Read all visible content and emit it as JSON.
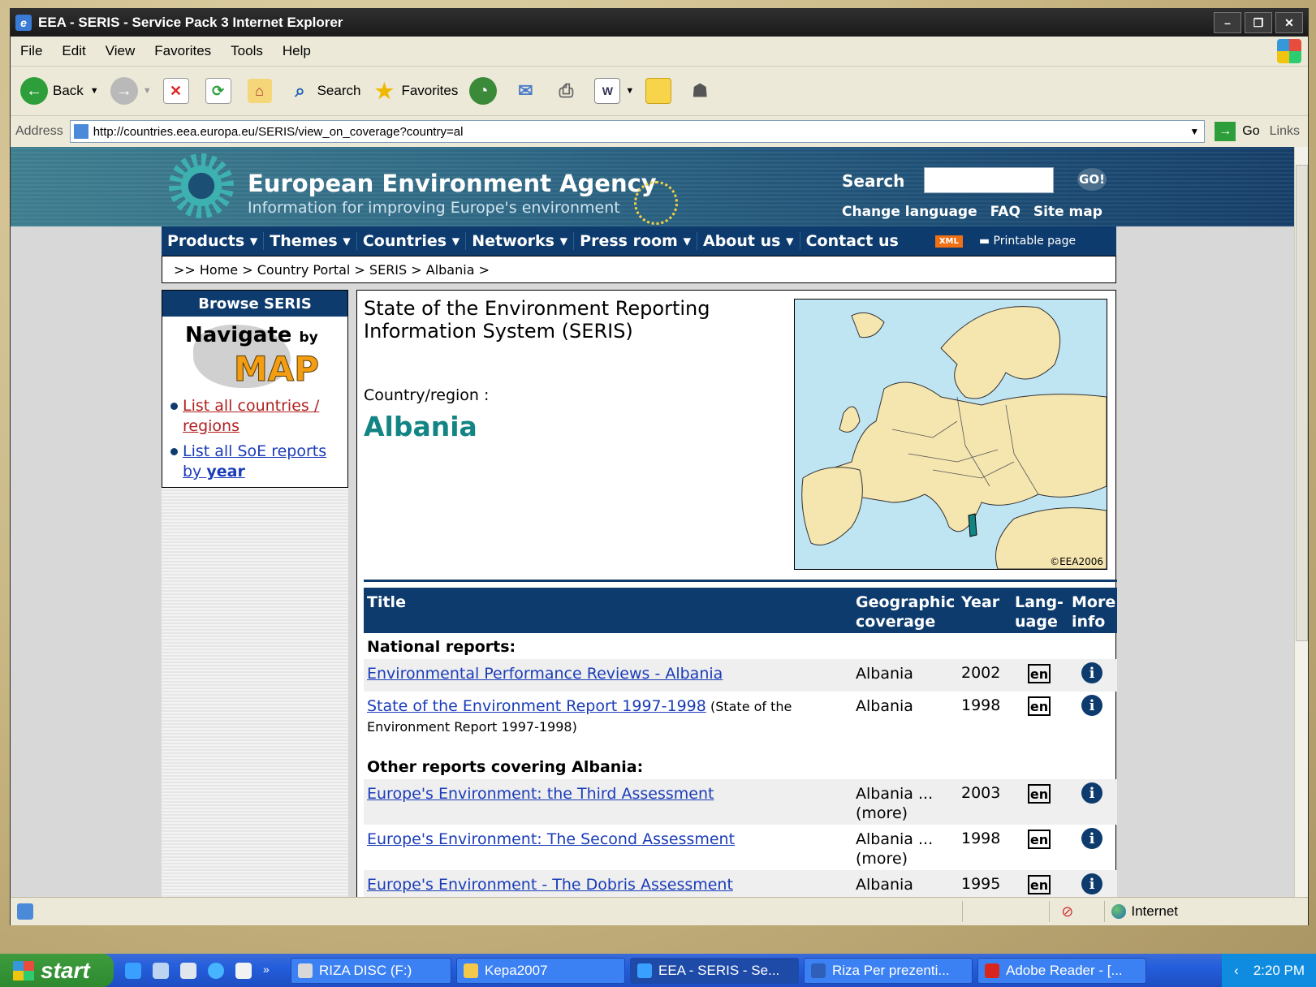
{
  "window": {
    "title": "EEA - SERIS - Service Pack 3 Internet Explorer"
  },
  "menu": [
    "File",
    "Edit",
    "View",
    "Favorites",
    "Tools",
    "Help"
  ],
  "toolbar": {
    "back": "Back",
    "search": "Search",
    "favorites": "Favorites"
  },
  "address": {
    "label": "Address",
    "url": "http://countries.eea.europa.eu/SERIS/view_on_coverage?country=al",
    "go": "Go",
    "links": "Links"
  },
  "header": {
    "agency": "European Environment Agency",
    "tagline": "Information for improving Europe's environment",
    "search_label": "Search",
    "go": "GO!",
    "links": [
      "Change language",
      "FAQ",
      "Site map"
    ]
  },
  "nav": [
    "Products ▾",
    "Themes ▾",
    "Countries ▾",
    "Networks ▾",
    "Press room ▾",
    "About us ▾",
    "Contact us"
  ],
  "nav_xml": "XML",
  "nav_printable": "Printable page",
  "breadcrumb": ">> Home > Country Portal > SERIS > Albania >",
  "sidebar": {
    "heading": "Browse SERIS",
    "navigate": "Navigate",
    "by": "by",
    "map": "MAP",
    "link1": "List all countries / regions",
    "link2_a": "List all SoE reports by ",
    "link2_b": "year"
  },
  "main": {
    "title": "State of the Environment Reporting Information System (SERIS)",
    "country_label": "Country/region :",
    "country": "Albania",
    "map_copyright": "©EEA2006"
  },
  "table": {
    "headers": {
      "title": "Title",
      "geo": "Geographic coverage",
      "year": "Year",
      "lang": "Lang- uage",
      "info": "More info"
    },
    "section1": "National reports:",
    "section2": "Other reports covering Albania:",
    "national": [
      {
        "title": "Environmental Performance Reviews - Albania",
        "note": "",
        "geo": "Albania",
        "year": "2002",
        "lang": "en"
      },
      {
        "title": "State of the Environment Report 1997-1998",
        "note": " (State of the Environment Report 1997-1998)",
        "geo": "Albania",
        "year": "1998",
        "lang": "en"
      }
    ],
    "other": [
      {
        "title": "Europe's Environment: the Third Assessment",
        "geo": "Albania ...(more)",
        "year": "2003",
        "lang": "en"
      },
      {
        "title": "Europe's Environment: The Second Assessment",
        "geo": "Albania ...(more)",
        "year": "1998",
        "lang": "en"
      },
      {
        "title": "Europe's Environment - The Dobris Assessment",
        "geo": "Albania",
        "year": "1995",
        "lang": "en"
      }
    ]
  },
  "status": {
    "zone": "Internet"
  },
  "taskbar": {
    "start": "start",
    "tasks": [
      "RIZA DISC (F:)",
      "Kepa2007",
      "EEA - SERIS - Se...",
      "Riza Per prezenti...",
      "Adobe Reader - [..."
    ],
    "clock": "2:20 PM"
  }
}
